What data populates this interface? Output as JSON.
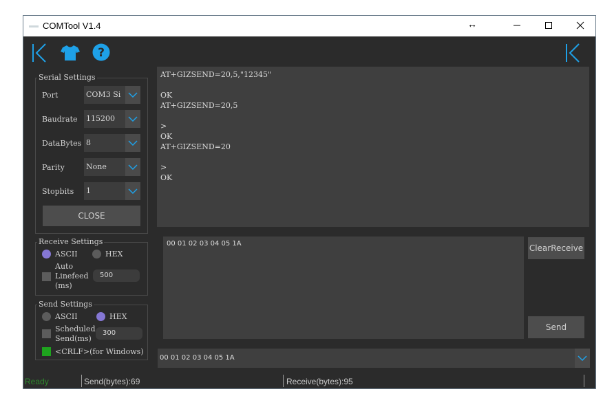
{
  "window": {
    "title": "COMTool V1.4",
    "minimize": "—",
    "maximize": "☐",
    "close": "✕",
    "resize_glyph": "↔"
  },
  "toolbar": {
    "left_icon": "collapse-left-icon",
    "skin_icon": "shirt-icon",
    "help_icon": "help-icon",
    "right_icon": "collapse-right-icon",
    "accent": "#1ea1e8"
  },
  "serial_settings": {
    "title": "Serial Settings",
    "port_label": "Port",
    "port_value": "COM3 Si",
    "baudrate_label": "Baudrate",
    "baudrate_value": "115200",
    "databytes_label": "DataBytes",
    "databytes_value": "8",
    "parity_label": "Parity",
    "parity_value": "None",
    "stopbits_label": "Stopbits",
    "stopbits_value": "1",
    "close_label": "CLOSE"
  },
  "receive_settings": {
    "title": "Receive Settings",
    "ascii_label": "ASCII",
    "hex_label": "HEX",
    "selected": "ASCII",
    "auto_linefeed_label": [
      "Auto",
      "Linefeed",
      "(ms)"
    ],
    "auto_linefeed_value": "500"
  },
  "send_settings": {
    "title": "Send Settings",
    "ascii_label": "ASCII",
    "hex_label": "HEX",
    "selected": "HEX",
    "scheduled_label": [
      "Scheduled",
      "Send(ms)"
    ],
    "scheduled_value": "300",
    "crlf_label": "<CRLF>(for Windows)"
  },
  "receive_area": {
    "lines": [
      "AT+GIZSEND=20,5,\"12345\"",
      "",
      "OK",
      "AT+GIZSEND=20,5",
      "",
      ">",
      "OK",
      "AT+GIZSEND=20",
      "",
      ">",
      "OK"
    ]
  },
  "send_area": {
    "content": "00 01 02 03 04 05 1A"
  },
  "buttons": {
    "clear_receive": "ClearReceive",
    "send": "Send"
  },
  "history": {
    "value": "00 01 02 03 04 05 1A"
  },
  "status": {
    "ready": "Ready",
    "send_bytes": "Send(bytes):69",
    "receive_bytes": "Receive(bytes):95"
  }
}
